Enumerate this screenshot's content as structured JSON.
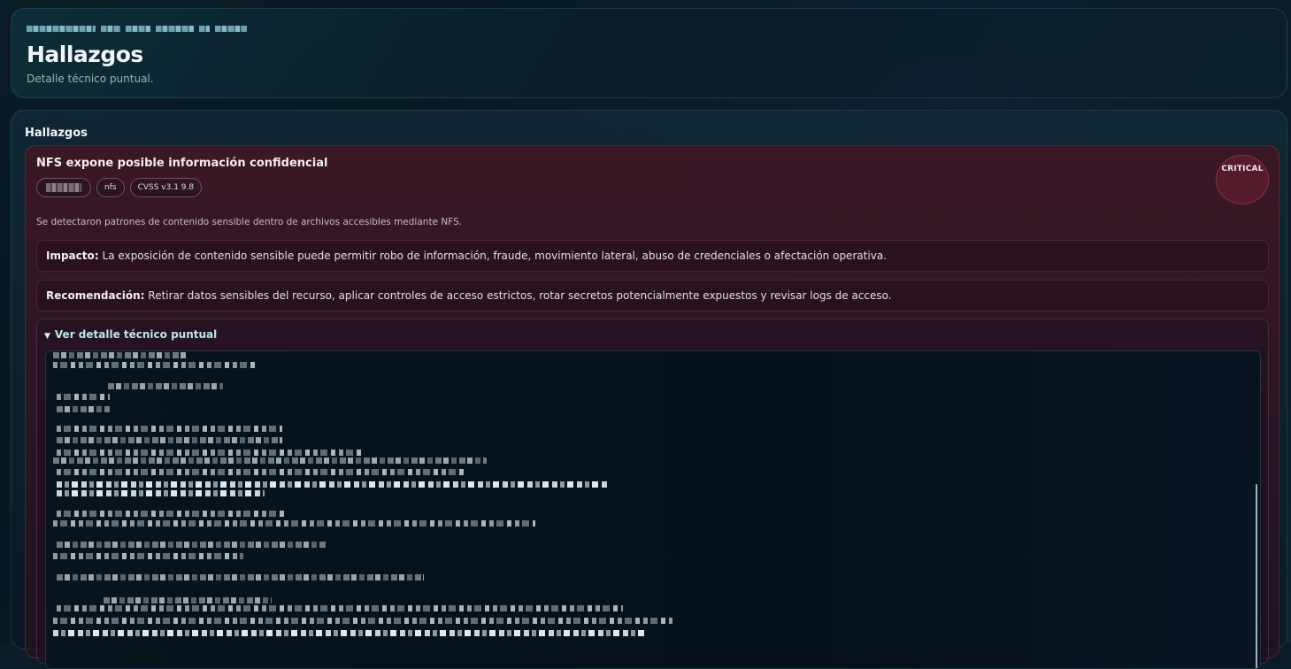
{
  "header": {
    "title": "Hallazgos",
    "subtitle": "Detalle técnico puntual."
  },
  "section": {
    "title": "Hallazgos"
  },
  "finding": {
    "title": "NFS expone posible información confidencial",
    "tags": {
      "service": "nfs",
      "cvss": "CVSS v3.1 9.8"
    },
    "severity": "CRITICAL",
    "description": "Se detectaron patrones de contenido sensible dentro de archivos accesibles mediante NFS.",
    "impact": {
      "label": "Impacto:",
      "text": "La exposición de contenido sensible puede permitir robo de información, fraude, movimiento lateral, abuso de credenciales o afectación operativa."
    },
    "recommendation": {
      "label": "Recomendación:",
      "text": "Retirar datos sensibles del recurso, aplicar controles de acceso estrictos, rotar secretos potencialmente expuestos y revisar logs de acceso."
    },
    "details_toggle": "Ver detalle técnico puntual"
  },
  "colors": {
    "severity_critical": "#7a1e32",
    "accent_cyan": "#b9e6ee"
  },
  "icons": {
    "details_toggle": "triangle-down-icon"
  }
}
